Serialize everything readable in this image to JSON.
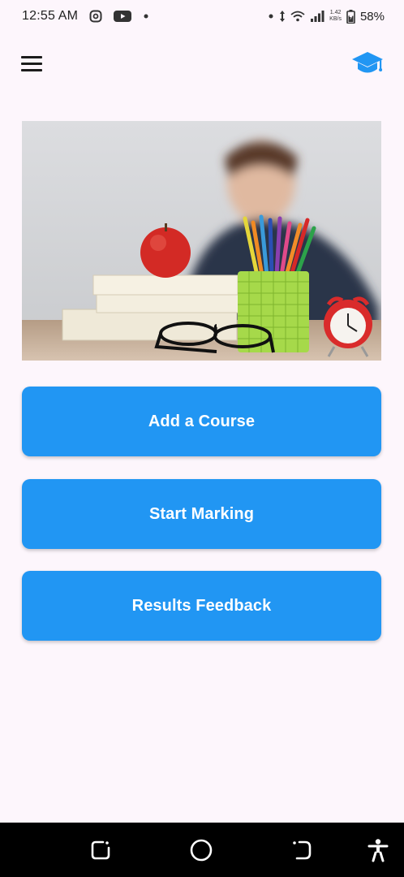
{
  "status_bar": {
    "time": "12:55 AM",
    "net_speed_value": "1.42",
    "net_speed_unit": "KB/s",
    "battery_percent": "58%",
    "icons": [
      "assistant-icon",
      "youtube-icon",
      "dot-icon",
      "dot-icon",
      "data-arrows-icon",
      "wifi-icon",
      "signal-icon",
      "battery-icon"
    ]
  },
  "app_bar": {
    "menu_icon": "hamburger-menu-icon",
    "logo_icon": "graduation-cap-icon",
    "accent_color": "#2196f3"
  },
  "hero": {
    "image_subject": "classroom desk with books, apple, pencil cup, glasses and alarm clock"
  },
  "actions": {
    "add_course_label": "Add a Course",
    "start_marking_label": "Start Marking",
    "results_feedback_label": "Results Feedback",
    "button_color": "#2196f3"
  },
  "nav_bar": {
    "icons": [
      "recents-icon",
      "home-icon",
      "back-icon",
      "accessibility-icon"
    ]
  }
}
